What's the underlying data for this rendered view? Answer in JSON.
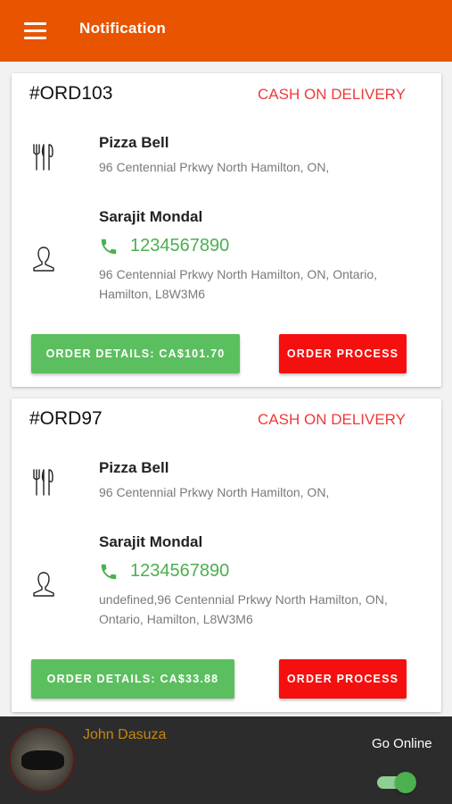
{
  "header": {
    "title": "Notification",
    "menu_icon": "hamburger-menu-icon"
  },
  "orders": [
    {
      "order_id": "#ORD103",
      "payment": "CASH ON DELIVERY",
      "restaurant_name": "Pizza Bell",
      "restaurant_address": "96 Centennial Prkwy North Hamilton, ON,",
      "customer_name": "Sarajit Mondal",
      "customer_phone": "1234567890",
      "customer_address": "96 Centennial Prkwy North Hamilton, ON, Ontario, Hamilton, L8W3M6",
      "details_label": "ORDER DETAILS: CA$101.70",
      "process_label": "ORDER PROCESS"
    },
    {
      "order_id": "#ORD97",
      "payment": "CASH ON DELIVERY",
      "restaurant_name": "Pizza Bell",
      "restaurant_address": "96 Centennial Prkwy North Hamilton, ON,",
      "customer_name": "Sarajit Mondal",
      "customer_phone": "1234567890",
      "customer_address": "undefined,96 Centennial Prkwy North Hamilton, ON, Ontario, Hamilton, L8W3M6",
      "details_label": "ORDER DETAILS: CA$33.88",
      "process_label": "ORDER PROCESS"
    }
  ],
  "footer": {
    "driver_name": "John Dasuza",
    "online_label": "Go Online",
    "online": true
  },
  "colors": {
    "header": "#e85400",
    "accent_green": "#5cbf5f",
    "accent_red": "#f50f0f",
    "payment_text": "#ee3a3a",
    "footer_bg": "#2c2c2c",
    "driver_name": "#c8860f"
  }
}
